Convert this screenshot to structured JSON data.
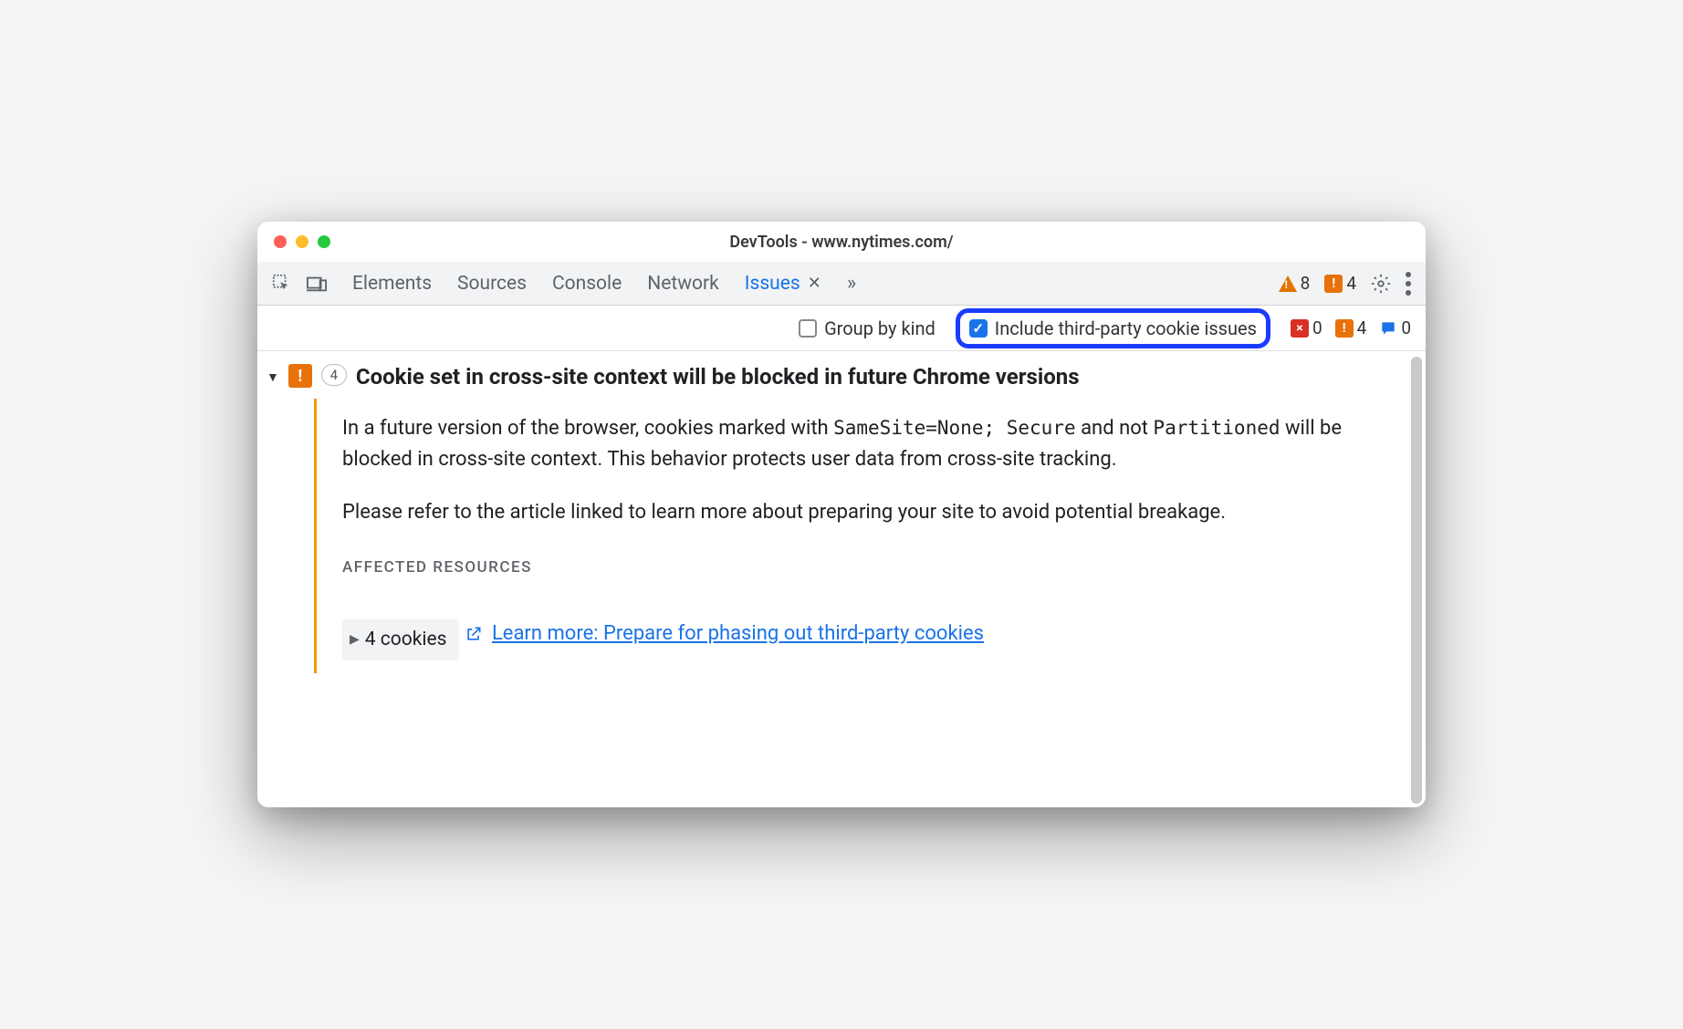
{
  "window": {
    "title": "DevTools - www.nytimes.com/"
  },
  "tabs": {
    "items": [
      "Elements",
      "Sources",
      "Console",
      "Network",
      "Issues"
    ],
    "active_index": 4
  },
  "tabbar_badges": {
    "warnings": "8",
    "breaking": "4"
  },
  "filter": {
    "group_by_kind_label": "Group by kind",
    "group_by_kind_checked": false,
    "include_third_party_label": "Include third-party cookie issues",
    "include_third_party_checked": true,
    "counts": {
      "errors": "0",
      "breaking": "4",
      "info": "0"
    }
  },
  "issue": {
    "count": "4",
    "title": "Cookie set in cross-site context will be blocked in future Chrome versions",
    "body_p1_a": "In a future version of the browser, cookies marked with ",
    "body_p1_code1": "SameSite=None; Secure",
    "body_p1_b": " and not ",
    "body_p1_code2": "Partitioned",
    "body_p1_c": " will be blocked in cross-site context. This behavior protects user data from cross-site tracking.",
    "body_p2": "Please refer to the article linked to learn more about preparing your site to avoid potential breakage.",
    "affected_label": "AFFECTED RESOURCES",
    "resources_label": "4 cookies",
    "learn_more": "Learn more: Prepare for phasing out third-party cookies"
  }
}
